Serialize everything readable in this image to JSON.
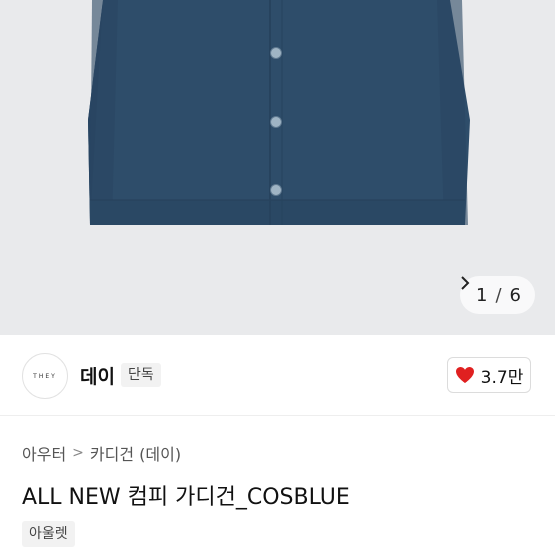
{
  "gallery": {
    "current": "1",
    "separator": "/",
    "total": "6",
    "colors": {
      "background": "#e9eaec",
      "garment": "#2e4d6a",
      "button": "#9fb4c4"
    }
  },
  "brand": {
    "logo_text": "THEY",
    "name": "데이",
    "badge": "단독",
    "like_count": "3.7만",
    "heart_color": "#e02020"
  },
  "breadcrumb": {
    "level1": "아우터",
    "separator": ">",
    "level2": "카디건 (데이)"
  },
  "product": {
    "title": "ALL NEW 컴피 가디건_COSBLUE",
    "tag": "아울렛"
  }
}
